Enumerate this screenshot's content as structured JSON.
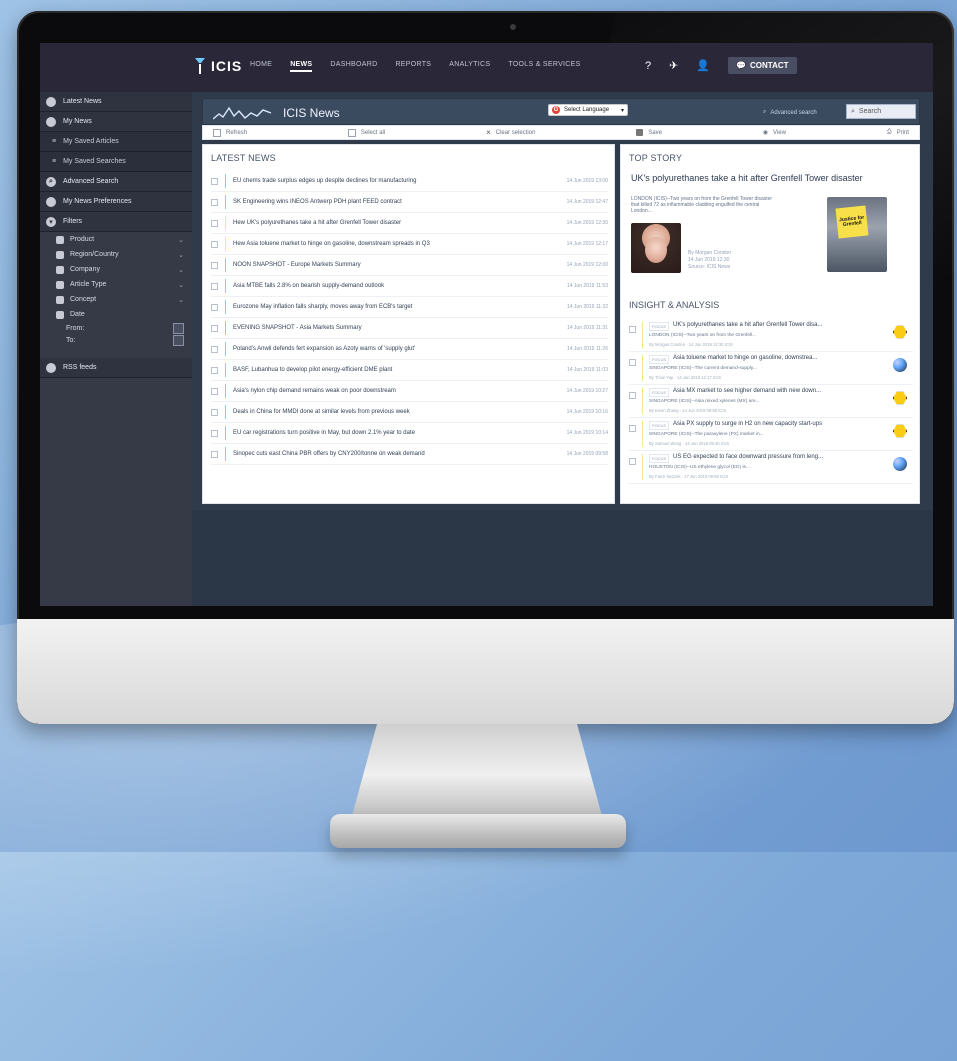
{
  "topnav": {
    "brand": "ICIS",
    "links": [
      "HOME",
      "NEWS",
      "DASHBOARD",
      "REPORTS",
      "ANALYTICS",
      "TOOLS & SERVICES"
    ],
    "active_index": 1,
    "contact_label": "CONTACT",
    "icons": {
      "help": "question-icon",
      "announcements": "megaphone-icon",
      "account": "user-icon",
      "contact": "chat-icon"
    }
  },
  "sidebar": {
    "items": [
      {
        "label": "Latest News",
        "icon": "news-icon",
        "type": "primary"
      },
      {
        "label": "My News",
        "icon": "my-news-icon",
        "type": "primary"
      },
      {
        "label": "My Saved Articles",
        "icon": "saved-articles-icon",
        "type": "sub"
      },
      {
        "label": "My Saved Searches",
        "icon": "saved-searches-icon",
        "type": "sub"
      },
      {
        "label": "Advanced Search",
        "icon": "search-icon",
        "type": "primary"
      },
      {
        "label": "My News Preferences",
        "icon": "preferences-icon",
        "type": "primary"
      },
      {
        "label": "Filters",
        "icon": "filter-icon",
        "type": "primary"
      }
    ],
    "filters": [
      {
        "label": "Product",
        "icon": "product-icon"
      },
      {
        "label": "Region/Country",
        "icon": "globe-icon"
      },
      {
        "label": "Company",
        "icon": "company-icon"
      },
      {
        "label": "Article Type",
        "icon": "article-icon"
      },
      {
        "label": "Concept",
        "icon": "concept-icon"
      }
    ],
    "date": {
      "label": "Date",
      "from_label": "From:",
      "to_label": "To:"
    },
    "rss": {
      "label": "RSS feeds",
      "icon": "rss-icon"
    }
  },
  "news_header": {
    "title": "ICIS News",
    "language_select": "Select Language",
    "advanced_search": "Advanced search",
    "search_placeholder": "Search"
  },
  "toolbar": {
    "refresh": "Refresh",
    "select_all": "Select all",
    "clear_selection": "Clear selection",
    "save": "Save",
    "view": "View",
    "print": "Print"
  },
  "latest_news": {
    "title": "LATEST NEWS",
    "items": [
      {
        "headline": "EU chems trade surplus edges up despite declines for manufacturing",
        "date": "14 Jun 2019 13:00",
        "accent": "blue"
      },
      {
        "headline": "SK Engineering wins INEOS Antwerp PDH plant FEED contract",
        "date": "14 Jun 2019 12:47",
        "accent": "blue"
      },
      {
        "headline": "Hew UK's polyurethanes take a hit after Grenfell Tower disaster",
        "date": "14 Jun 2019 12:30",
        "accent": "yellow"
      },
      {
        "headline": "Hew Asia toluene market to hinge on gasoline, downstream spreads in Q3",
        "date": "14 Jun 2019 12:17",
        "accent": "yellow"
      },
      {
        "headline": "NOON SNAPSHOT - Europe Markets Summary",
        "date": "14 Jun 2019 12:00",
        "accent": "blue"
      },
      {
        "headline": "Asia MTBE falls 2.8% on bearish supply-demand outlook",
        "date": "14 Jun 2019 11:53",
        "accent": "blue"
      },
      {
        "headline": "Eurozone May inflation falls sharply, moves away from ECB's target",
        "date": "14 Jun 2019 11:32",
        "accent": "blue"
      },
      {
        "headline": "EVENING SNAPSHOT - Asia Markets Summary",
        "date": "14 Jun 2019 11:31",
        "accent": "blue"
      },
      {
        "headline": "Poland's Anwil defends fert expansion as Azoty warns of 'supply glut'",
        "date": "14 Jun 2019 11:26",
        "accent": "blue"
      },
      {
        "headline": "BASF, Lubanhua to develop pilot energy-efficient DME plant",
        "date": "14 Jun 2019 11:03",
        "accent": "blue"
      },
      {
        "headline": "Asia's nylon chip demand remains weak on poor downstream",
        "date": "14 Jun 2019 10:27",
        "accent": "blue"
      },
      {
        "headline": "Deals in China for MMDI done at similar levels from previous week",
        "date": "14 Jun 2019 10:16",
        "accent": "blue"
      },
      {
        "headline": "EU car registrations turn positive in May, but down 2.1% year to date",
        "date": "14 Jun 2019 10:14",
        "accent": "blue"
      },
      {
        "headline": "Sinopec cuts east China PBR offers by CNY200/tonne on weak demand",
        "date": "14 Jun 2019 09:58",
        "accent": "blue"
      }
    ]
  },
  "top_story": {
    "title": "TOP STORY",
    "headline": "UK's polyurethanes take a hit after Grenfell Tower disaster",
    "excerpt": "LONDON (ICIS)--Two years on from the Grenfell Tower disaster that killed 72 as inflammable cladding engulfed the central London...",
    "meta_author": "By Morgan Condon",
    "meta_date": "14 Jun 2019 12:30",
    "meta_source": "Source: ICIS News",
    "placard_text": "Justice for Grenfell"
  },
  "insight": {
    "title": "INSIGHT & ANALYSIS",
    "items": [
      {
        "tag": "FOCUS",
        "headline": "UK's polyurethanes take a hit after Grenfell Tower disa...",
        "sub": "LONDON (ICIS)--Two years on from the Grenfell...",
        "meta": "By Morgan Condon · 14 Jun 2019 12:30 ICIS",
        "icon": "hex-icon"
      },
      {
        "tag": "FOCUS",
        "headline": "Asia toluene market to hinge on gasoline, downstrea...",
        "sub": "SINGAPORE (ICIS)--The current demand-supply...",
        "meta": "By Trixie Yap · 14 Jun 2019 12:17 ICIS",
        "icon": "molecule-icon"
      },
      {
        "tag": "FOCUS",
        "headline": "Asia MX market to see higher demand with new down...",
        "sub": "SINGAPORE (ICIS)--Asia mixed xylenes (MX) are...",
        "meta": "By Kevin Zhang · 14 Jun 2019 09:58 ICIS",
        "icon": "hex-icon"
      },
      {
        "tag": "FOCUS",
        "headline": "Asia PX supply to surge in H2 on new capacity start-ups",
        "sub": "SINGAPORE (ICIS)--The paraxylene (PX) market in...",
        "meta": "By Samuel Wong · 14 Jun 2019 09:30 ICIS",
        "icon": "hex-icon"
      },
      {
        "tag": "FOCUS",
        "headline": "US EG expected to face downward pressure from leng...",
        "sub": "HOUSTON (ICIS)--US ethylene glycol (EG) is...",
        "meta": "By Fanzi Nezzek · 17 Jun 2019 09:58 ICIS",
        "icon": "molecule-icon"
      }
    ]
  }
}
